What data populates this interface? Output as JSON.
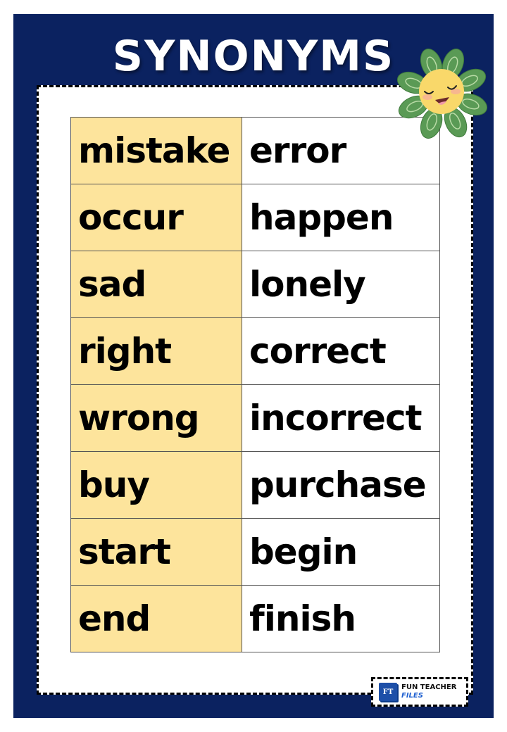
{
  "poster": {
    "title": "SYNONYMS",
    "colors": {
      "background": "#0b2260",
      "panel": "#ffffff",
      "word_column": "#fde49c",
      "synonym_column": "#ffffff"
    }
  },
  "pairs": [
    {
      "word": "mistake",
      "synonym": "error"
    },
    {
      "word": "occur",
      "synonym": "happen"
    },
    {
      "word": "sad",
      "synonym": "lonely"
    },
    {
      "word": "right",
      "synonym": "correct"
    },
    {
      "word": "wrong",
      "synonym": "incorrect"
    },
    {
      "word": "buy",
      "synonym": "purchase"
    },
    {
      "word": "start",
      "synonym": "begin"
    },
    {
      "word": "end",
      "synonym": "finish"
    }
  ],
  "decoration": {
    "icon": "smiling-flower-icon"
  },
  "logo": {
    "badge": "FT",
    "line1": "FUN TEACHER",
    "line2": "FILES"
  }
}
